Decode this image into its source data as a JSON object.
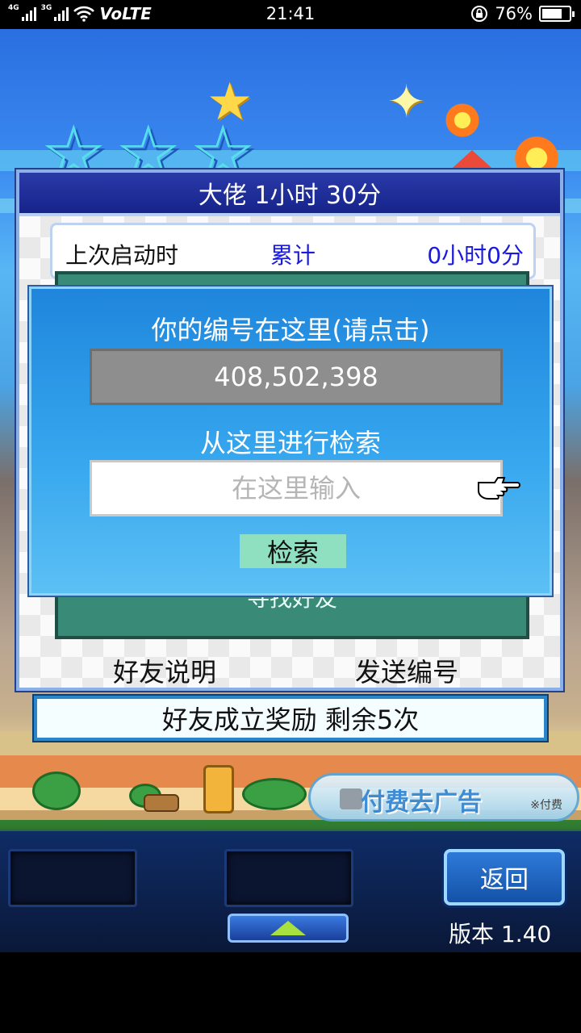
{
  "status_bar": {
    "network_label": "4G",
    "network_label_2": "3G",
    "volte": "VoLTE",
    "time": "21:41",
    "battery_percent": "76%",
    "battery_level": 0.76
  },
  "scene": {
    "ad_banner_text": "付费去广告",
    "ad_banner_sub": "※付费"
  },
  "friend_dialog": {
    "title": "大佬  1小时 30分",
    "last_launch_label": "上次启动时",
    "total_label": "累计",
    "total_value": "0小时0分",
    "find_friend_label": "寻找好友",
    "friend_info_button": "好友说明",
    "send_id_button": "发送编号"
  },
  "reward_bar": {
    "text": "好友成立奖励  剩余5次"
  },
  "search_popup": {
    "title": "你的编号在这里(请点击)",
    "user_id": "408,502,398",
    "search_label": "从这里进行检索",
    "search_placeholder": "在这里输入",
    "search_button": "检索"
  },
  "bottom_controls": {
    "back_button": "返回",
    "version": "版本 1.40"
  },
  "colors": {
    "dialog_title_bg": "#16238a",
    "popup_bg": "#36a6ee",
    "id_box_bg": "#8e8e8e",
    "search_button_bg": "#8fe0c0",
    "link_blue": "#1a1adf"
  },
  "icons": [
    "signal-icon",
    "wifi-icon",
    "lock-rotate-icon",
    "battery-icon",
    "pointing-hand-icon",
    "up-arrow-icon"
  ]
}
